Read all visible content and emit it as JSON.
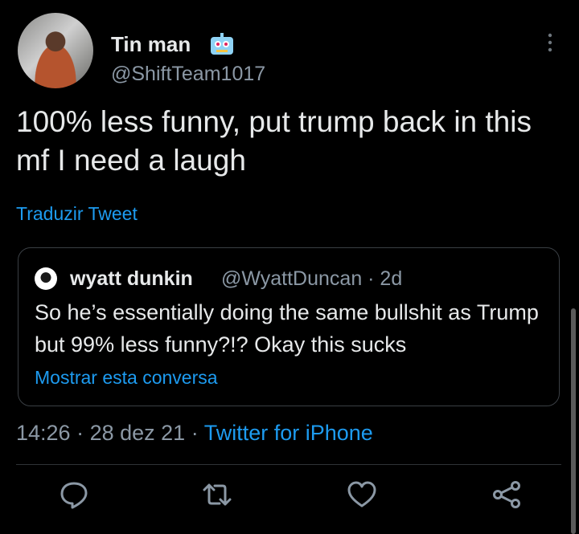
{
  "tweet": {
    "author": {
      "display_name": "Tin man",
      "handle": "@ShiftTeam1017"
    },
    "text": "100% less funny, put trump back in this mf I need a laugh",
    "translate_label": "Traduzir Tweet",
    "time": "14:26",
    "date": "28 dez 21",
    "source": "Twitter for iPhone"
  },
  "quote": {
    "display_name": "wyatt dunkin",
    "handle_time": "@WyattDuncan · 2d",
    "text": "So he’s essentially doing the same bullshit as Trump but 99% less funny?!? Okay this sucks",
    "show_label": "Mostrar esta conversa"
  },
  "icons": {
    "emoji": "robot-emoji-icon",
    "more": "more-vertical-icon",
    "reply": "reply-icon",
    "retweet": "retweet-icon",
    "like": "like-icon",
    "share": "share-icon"
  },
  "colors": {
    "background": "#000000",
    "text": "#e7e9ea",
    "muted": "#8b98a5",
    "accent": "#1d9bf0"
  }
}
